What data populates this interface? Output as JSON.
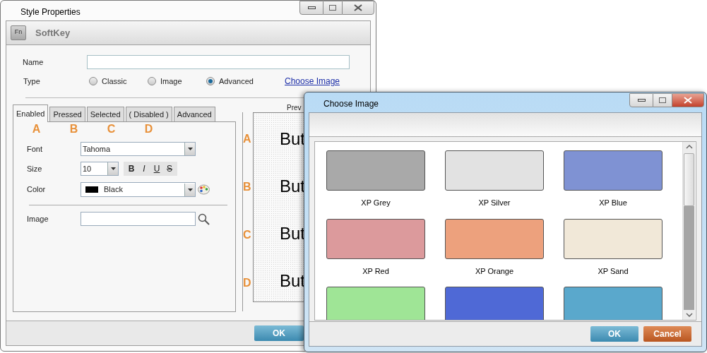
{
  "main_window": {
    "title": "Style Properties",
    "header": "SoftKey",
    "header_icon": "Fn",
    "name_label": "Name",
    "type_label": "Type",
    "type_options": [
      {
        "label": "Classic",
        "selected": false
      },
      {
        "label": "Image",
        "selected": false
      },
      {
        "label": "Advanced",
        "selected": true
      }
    ],
    "choose_image_link": "Choose Image",
    "tabs": [
      {
        "label": "Enabled",
        "selected": true,
        "marker": "A"
      },
      {
        "label": "Pressed",
        "selected": false,
        "marker": "B"
      },
      {
        "label": "Selected",
        "selected": false,
        "marker": "C"
      },
      {
        "label": "( Disabled )",
        "selected": false,
        "marker": "D"
      },
      {
        "label": "Advanced",
        "selected": false
      }
    ],
    "font": {
      "label": "Font",
      "value": "Tahoma"
    },
    "size": {
      "label": "Size",
      "value": "10"
    },
    "style_buttons": [
      "B",
      "I",
      "U",
      "S"
    ],
    "color": {
      "label": "Color",
      "value": "Black"
    },
    "image": {
      "label": "Image"
    },
    "preview": {
      "label": "Prev",
      "rows": [
        {
          "marker": "A",
          "text": "But"
        },
        {
          "marker": "B",
          "text": "But"
        },
        {
          "marker": "C",
          "text": "But"
        },
        {
          "marker": "D",
          "text": "But"
        }
      ]
    },
    "ok_button": "OK"
  },
  "dialog": {
    "title": "Choose Image",
    "tiles": [
      {
        "label": "XP Grey",
        "color": "#a9a9a9"
      },
      {
        "label": "XP Silver",
        "color": "#e2e2e2"
      },
      {
        "label": "XP Blue",
        "color": "#7f92d3"
      },
      {
        "label": "XP Red",
        "color": "#dc9a9c"
      },
      {
        "label": "XP Orange",
        "color": "#eda17d"
      },
      {
        "label": "XP Sand",
        "color": "#f1e8d8"
      },
      {
        "color": "#9fe596"
      },
      {
        "color": "#4f69d6"
      },
      {
        "color": "#5aa8cc"
      }
    ],
    "buttons": [
      {
        "label": "OK",
        "kind": "primary"
      },
      {
        "label": "Cancel",
        "kind": "cancel"
      }
    ]
  }
}
